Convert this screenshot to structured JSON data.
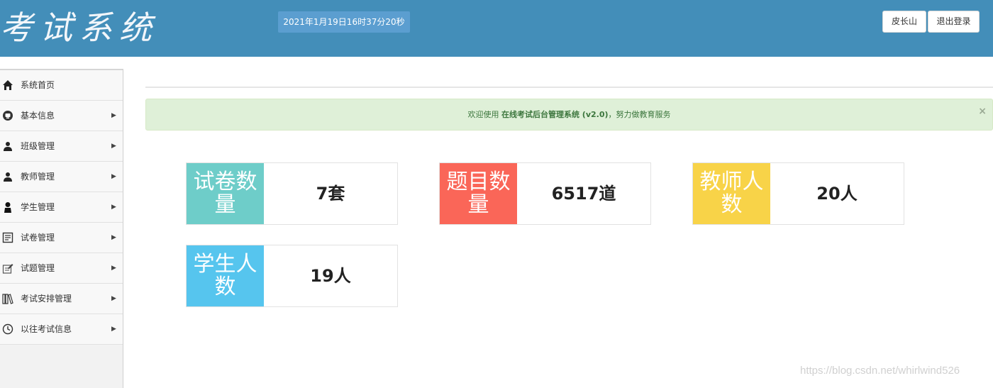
{
  "header": {
    "logo_text": "考试系统",
    "datetime": "2021年1月19日16时37分20秒",
    "user_label": "皮长山",
    "logout_label": "退出登录",
    "bg_color": "#438eb9"
  },
  "sidebar": {
    "items": [
      {
        "label": "系统首页",
        "icon": "home-icon",
        "has_arrow": false
      },
      {
        "label": "基本信息",
        "icon": "info-icon",
        "has_arrow": true
      },
      {
        "label": "班级管理",
        "icon": "users-icon",
        "has_arrow": true
      },
      {
        "label": "教师管理",
        "icon": "users-icon",
        "has_arrow": true
      },
      {
        "label": "学生管理",
        "icon": "user-icon",
        "has_arrow": true
      },
      {
        "label": "试卷管理",
        "icon": "document-icon",
        "has_arrow": true
      },
      {
        "label": "试题管理",
        "icon": "edit-icon",
        "has_arrow": true
      },
      {
        "label": "考试安排管理",
        "icon": "books-icon",
        "has_arrow": true
      },
      {
        "label": "以往考试信息",
        "icon": "clock-icon",
        "has_arrow": true
      }
    ],
    "arrow_glyph": "▶"
  },
  "alert": {
    "prefix": "欢迎使用 ",
    "system_name": "在线考试后台管理系统",
    "version": " (v2.0)",
    "suffix": "，努力做教育服务",
    "close_glyph": "×"
  },
  "stats": [
    {
      "label": "试卷数量",
      "value": "7套",
      "color": "#6ecdc9"
    },
    {
      "label": "题目数量",
      "value": "6517道",
      "color": "#fa6658"
    },
    {
      "label": "教师人数",
      "value": "20人",
      "color": "#f8d348"
    },
    {
      "label": "学生人数",
      "value": "19人",
      "color": "#56c5ee"
    }
  ],
  "watermark": "https://blog.csdn.net/whirlwind526"
}
